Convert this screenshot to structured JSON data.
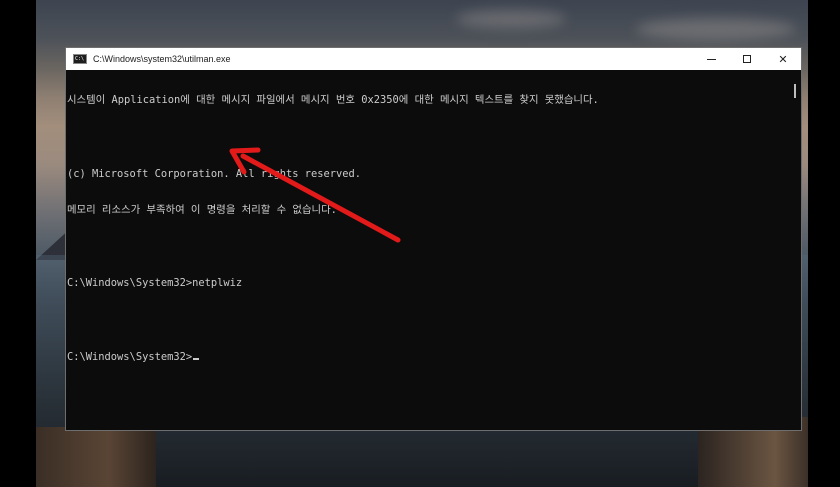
{
  "window": {
    "title": "C:\\Windows\\system32\\utilman.exe",
    "icon": "console-app-icon",
    "icon_text": "C:\\",
    "buttons": {
      "minimize_icon": "minimize-icon",
      "maximize_icon": "maximize-icon",
      "close_label": "✕"
    }
  },
  "console": {
    "lines": [
      "시스템이 Application에 대한 메시지 파일에서 메시지 번호 0x2350에 대한 메시지 텍스트를 찾지 못했습니다.",
      "",
      "(c) Microsoft Corporation. All rights reserved.",
      "메모리 리소스가 부족하여 이 명령을 처리할 수 없습니다.",
      "",
      "C:\\Windows\\System32>netplwiz",
      "",
      "C:\\Windows\\System32>"
    ],
    "text_color": "#cccccc",
    "background": "#0c0c0c"
  },
  "annotation": {
    "arrow_color": "#e21a1a",
    "arrow_icon": "red-arrow-annotation"
  }
}
